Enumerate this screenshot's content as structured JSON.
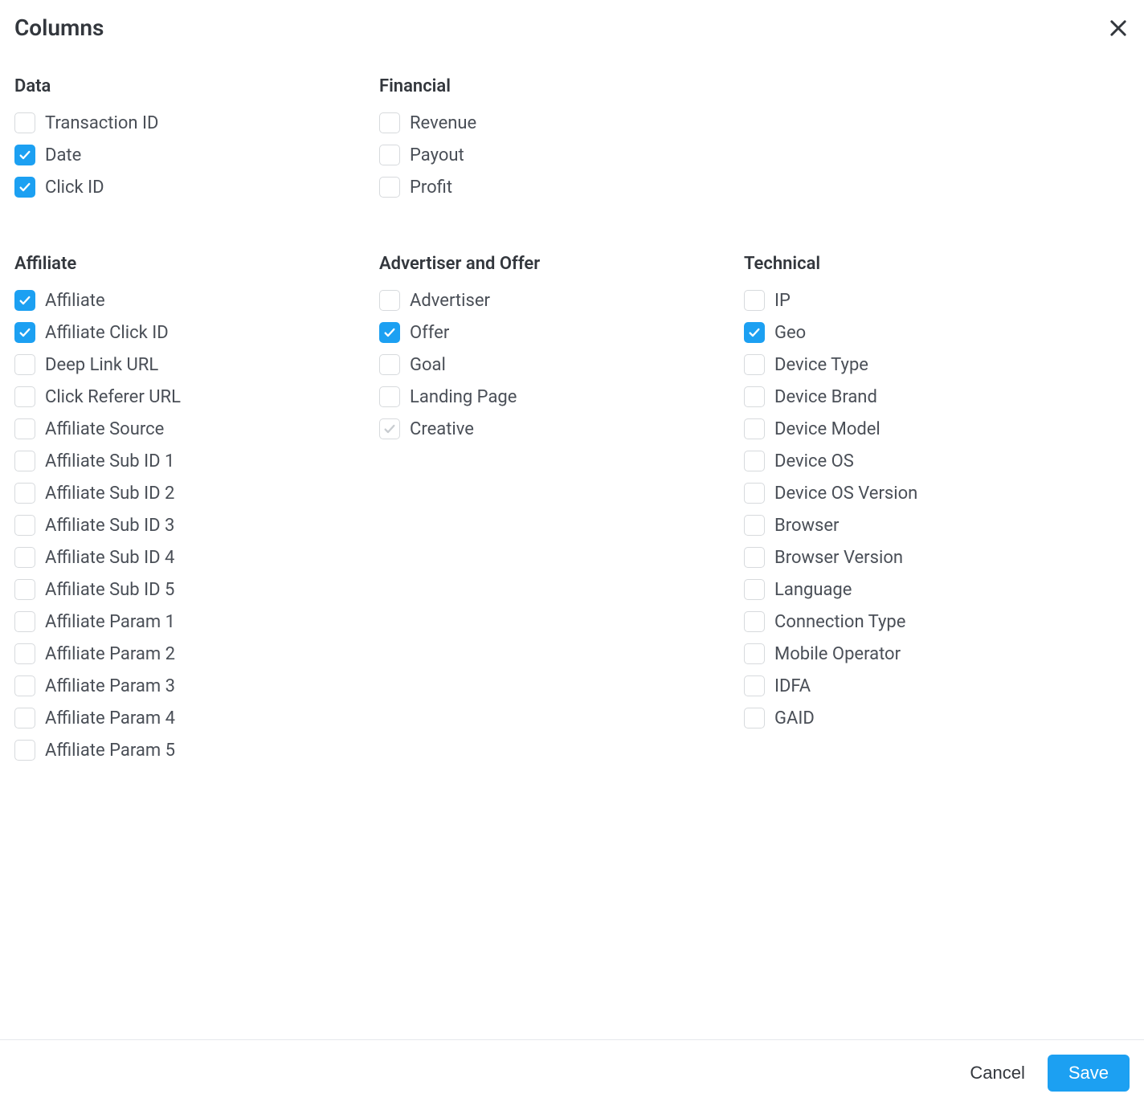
{
  "dialog": {
    "title": "Columns",
    "cancel_label": "Cancel",
    "save_label": "Save"
  },
  "groups": [
    {
      "heading": "Data",
      "items": [
        {
          "label": "Transaction ID",
          "checked": false,
          "disabled": false
        },
        {
          "label": "Date",
          "checked": true,
          "disabled": false
        },
        {
          "label": "Click ID",
          "checked": true,
          "disabled": false
        }
      ]
    },
    {
      "heading": "Financial",
      "items": [
        {
          "label": "Revenue",
          "checked": false,
          "disabled": false
        },
        {
          "label": "Payout",
          "checked": false,
          "disabled": false
        },
        {
          "label": "Profit",
          "checked": false,
          "disabled": false
        }
      ]
    },
    {
      "heading": "Affiliate",
      "items": [
        {
          "label": "Affiliate",
          "checked": true,
          "disabled": false
        },
        {
          "label": "Affiliate Click ID",
          "checked": true,
          "disabled": false
        },
        {
          "label": "Deep Link URL",
          "checked": false,
          "disabled": false
        },
        {
          "label": "Click Referer URL",
          "checked": false,
          "disabled": false
        },
        {
          "label": "Affiliate Source",
          "checked": false,
          "disabled": false
        },
        {
          "label": "Affiliate Sub ID 1",
          "checked": false,
          "disabled": false
        },
        {
          "label": "Affiliate Sub ID 2",
          "checked": false,
          "disabled": false
        },
        {
          "label": "Affiliate Sub ID 3",
          "checked": false,
          "disabled": false
        },
        {
          "label": "Affiliate Sub ID 4",
          "checked": false,
          "disabled": false
        },
        {
          "label": "Affiliate Sub ID 5",
          "checked": false,
          "disabled": false
        },
        {
          "label": "Affiliate Param 1",
          "checked": false,
          "disabled": false
        },
        {
          "label": "Affiliate Param 2",
          "checked": false,
          "disabled": false
        },
        {
          "label": "Affiliate Param 3",
          "checked": false,
          "disabled": false
        },
        {
          "label": "Affiliate Param 4",
          "checked": false,
          "disabled": false
        },
        {
          "label": "Affiliate Param 5",
          "checked": false,
          "disabled": false
        }
      ]
    },
    {
      "heading": "Advertiser and Offer",
      "items": [
        {
          "label": "Advertiser",
          "checked": false,
          "disabled": false
        },
        {
          "label": "Offer",
          "checked": true,
          "disabled": false
        },
        {
          "label": "Goal",
          "checked": false,
          "disabled": false
        },
        {
          "label": "Landing Page",
          "checked": false,
          "disabled": false
        },
        {
          "label": "Creative",
          "checked": true,
          "disabled": true
        }
      ]
    },
    {
      "heading": "Technical",
      "items": [
        {
          "label": "IP",
          "checked": false,
          "disabled": false
        },
        {
          "label": "Geo",
          "checked": true,
          "disabled": false
        },
        {
          "label": "Device Type",
          "checked": false,
          "disabled": false
        },
        {
          "label": "Device Brand",
          "checked": false,
          "disabled": false
        },
        {
          "label": "Device Model",
          "checked": false,
          "disabled": false
        },
        {
          "label": "Device OS",
          "checked": false,
          "disabled": false
        },
        {
          "label": "Device OS Version",
          "checked": false,
          "disabled": false
        },
        {
          "label": "Browser",
          "checked": false,
          "disabled": false
        },
        {
          "label": "Browser Version",
          "checked": false,
          "disabled": false
        },
        {
          "label": "Language",
          "checked": false,
          "disabled": false
        },
        {
          "label": "Connection Type",
          "checked": false,
          "disabled": false
        },
        {
          "label": "Mobile Operator",
          "checked": false,
          "disabled": false
        },
        {
          "label": "IDFA",
          "checked": false,
          "disabled": false
        },
        {
          "label": "GAID",
          "checked": false,
          "disabled": false
        }
      ]
    }
  ],
  "layout_row_breaks_after_group_index": [
    1
  ],
  "colors": {
    "accent": "#1ca0f2"
  }
}
